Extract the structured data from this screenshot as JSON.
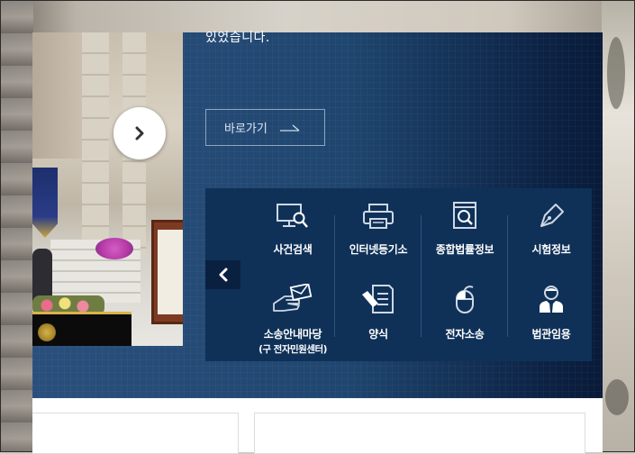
{
  "banner": {
    "top_text": "있었습니다.",
    "goto_label": "바로가기"
  },
  "carousel": {
    "next_icon": "chevron-right-icon",
    "prev_icon": "chevron-left-icon"
  },
  "quick_menu": {
    "items": [
      {
        "label": "사건검색",
        "sub": "",
        "icon": "monitor-search-icon"
      },
      {
        "label": "인터넷등기소",
        "sub": "",
        "icon": "printer-icon"
      },
      {
        "label": "종합법률정보",
        "sub": "",
        "icon": "book-search-icon"
      },
      {
        "label": "시험정보",
        "sub": "",
        "icon": "pen-nib-icon"
      },
      {
        "label": "소송안내마당",
        "sub": "(구 전자민원센터)",
        "icon": "hand-envelope-icon"
      },
      {
        "label": "양식",
        "sub": "",
        "icon": "form-pen-icon"
      },
      {
        "label": "전자소송",
        "sub": "",
        "icon": "mouse-icon"
      },
      {
        "label": "법관임용",
        "sub": "",
        "icon": "judge-person-icon"
      }
    ]
  },
  "colors": {
    "panel": "#1f466f",
    "menu_bg": "#0f3158",
    "text": "#ffffff"
  }
}
